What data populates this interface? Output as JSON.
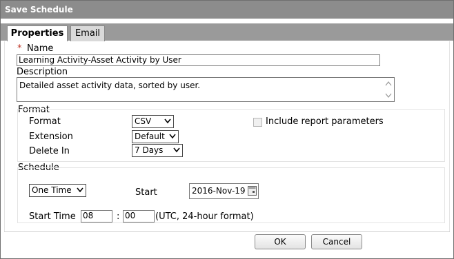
{
  "window": {
    "title": "Save Schedule"
  },
  "tabs": [
    {
      "label": "Properties"
    },
    {
      "label": "Email"
    }
  ],
  "properties": {
    "required_marker": "*",
    "name_label": "Name",
    "name_value": "Learning Activity-Asset Activity by User",
    "description_label": "Description",
    "description_value": "Detailed asset activity data, sorted by user."
  },
  "format_group": {
    "legend": "Format",
    "format_label": "Format",
    "format_value": "CSV",
    "extension_label": "Extension",
    "extension_value": "Default",
    "delete_in_label": "Delete In",
    "delete_in_value": "7 Days",
    "include_params_label": "Include report parameters",
    "include_params_checked": false
  },
  "schedule_group": {
    "legend": "Schedule",
    "frequency_value": "One Time",
    "start_label": "Start",
    "start_date": "2016-Nov-19",
    "start_time_label": "Start Time",
    "hour_value": "08",
    "time_separator": ":",
    "minute_value": "00",
    "time_hint": "(UTC, 24-hour format)"
  },
  "buttons": {
    "ok": "OK",
    "cancel": "Cancel"
  },
  "icons": {
    "dropdown": "chevron-down-icon",
    "calendar": "calendar-icon",
    "scroll_up": "scroll-up-icon",
    "scroll_down": "scroll-down-icon"
  }
}
